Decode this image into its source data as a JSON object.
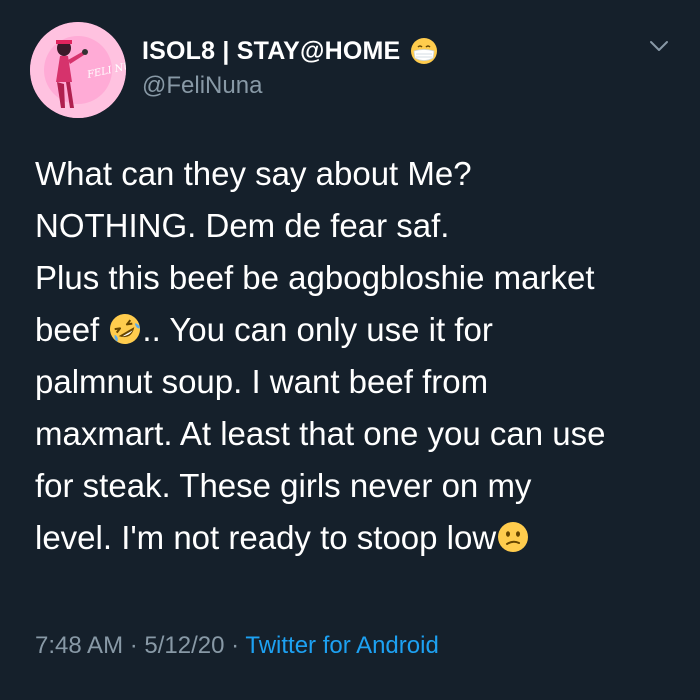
{
  "author": {
    "display_name": "ISOL8 | STAY@HOME",
    "handle": "@FeliNuna",
    "avatar_text": "FELI NUNA",
    "name_emoji": "face-with-medical-mask-emoji"
  },
  "tweet": {
    "text_lines": [
      "What can they say about Me?",
      "NOTHING. Dem de fear saf.",
      "Plus this beef be agbogbloshie market",
      "beef",
      ".. You can only use it for",
      "palmnut soup. I want beef from",
      "maxmart. At least that one you can use",
      "for steak. These girls never on my",
      "level. I'm not ready to stoop low"
    ],
    "emojis": [
      "rolling-on-floor-laughing-emoji",
      "confused-face-emoji"
    ]
  },
  "meta": {
    "time": "7:48 AM",
    "separator": " · ",
    "date": "5/12/20",
    "source": "Twitter for Android"
  },
  "colors": {
    "background": "#15202b",
    "text": "#ffffff",
    "secondary": "#8899a6",
    "link": "#1da1f2"
  }
}
